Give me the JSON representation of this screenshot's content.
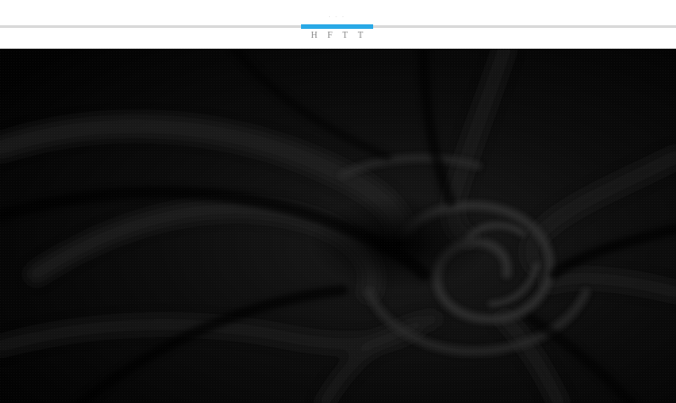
{
  "header": {
    "caption": "· · ·",
    "letters": "HFTT",
    "accent_color": "#29a9e6",
    "divider_color": "#d9d9d9"
  },
  "photo": {
    "subject": "black-knit-fabric-swirl",
    "base_color": "#050505"
  }
}
